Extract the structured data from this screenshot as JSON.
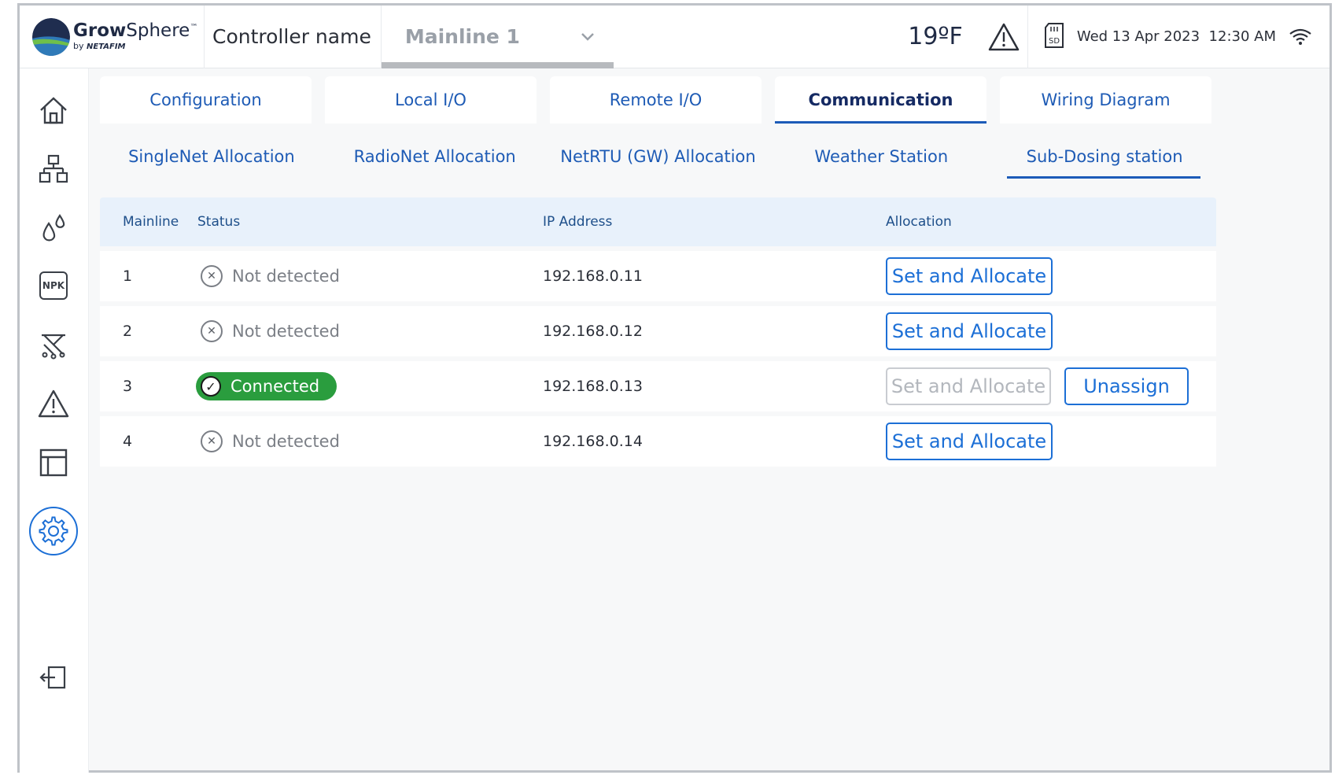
{
  "header": {
    "logo_name_bold": "Grow",
    "logo_name_rest": "Sphere",
    "logo_tm": "™",
    "logo_by": "by",
    "logo_brand": "NETAFIM",
    "controller_label": "Controller name",
    "mainline_value": "Mainline 1",
    "temperature": "19ºF",
    "date": "Wed 13 Apr 2023",
    "time": "12:30 AM",
    "sd_label": "SD"
  },
  "sidebar": {
    "items": [
      {
        "icon": "home-icon"
      },
      {
        "icon": "network-icon"
      },
      {
        "icon": "water-drops-icon"
      },
      {
        "icon": "npk-icon",
        "label": "NPK"
      },
      {
        "icon": "sprinkler-icon"
      },
      {
        "icon": "alarm-icon"
      },
      {
        "icon": "table-icon"
      },
      {
        "icon": "settings-icon",
        "active": true
      }
    ],
    "logout_icon": "logout-icon"
  },
  "tabs": [
    "Configuration",
    "Local I/O",
    "Remote I/O",
    "Communication",
    "Wiring Diagram"
  ],
  "active_tab": "Communication",
  "subtabs": [
    "SingleNet Allocation",
    "RadioNet Allocation",
    "NetRTU (GW) Allocation",
    "Weather Station",
    "Sub-Dosing station"
  ],
  "active_subtab": "Sub-Dosing station",
  "table": {
    "headers": [
      "Mainline",
      "Status",
      "IP Address",
      "Allocation"
    ],
    "rows": [
      {
        "mainline": "1",
        "status": "Not detected",
        "ip": "192.168.0.11",
        "alloc": "Set and Allocate"
      },
      {
        "mainline": "2",
        "status": "Not detected",
        "ip": "192.168.0.12",
        "alloc": "Set and Allocate"
      },
      {
        "mainline": "3",
        "status": "Connected",
        "ip": "192.168.0.13",
        "alloc": "Set and Allocate",
        "unassign": "Unassign"
      },
      {
        "mainline": "4",
        "status": "Not detected",
        "ip": "192.168.0.14",
        "alloc": "Set and Allocate"
      }
    ]
  },
  "colors": {
    "accent": "#1c6fd6",
    "connected": "#2a9d3e",
    "header_bg": "#e8f1fb"
  }
}
